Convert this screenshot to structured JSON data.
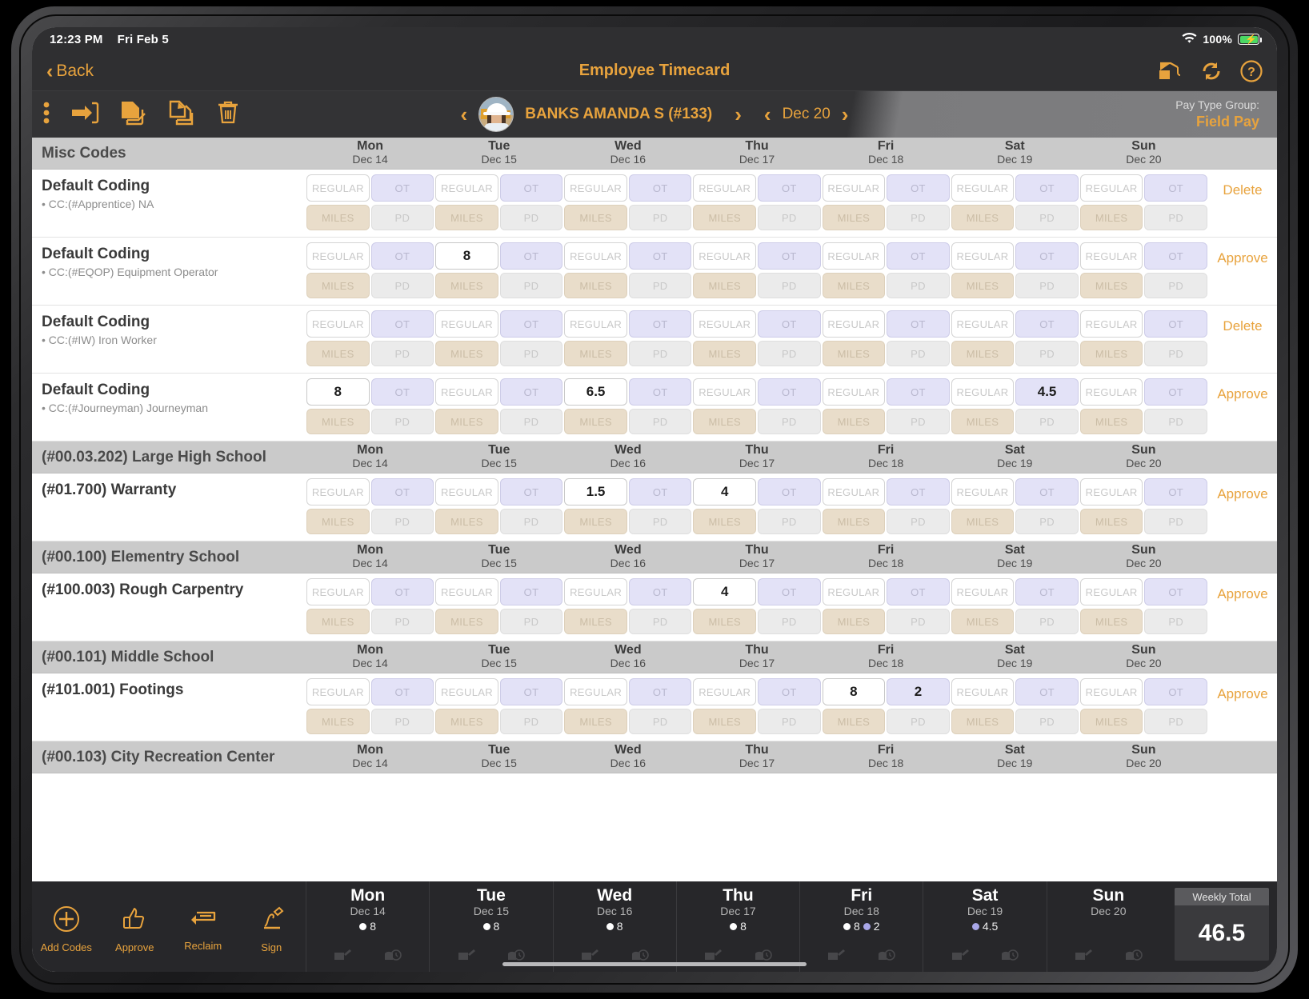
{
  "status_bar": {
    "time": "12:23 PM",
    "date": "Fri Feb 5",
    "battery_pct": "100%"
  },
  "nav": {
    "back_label": "Back",
    "title": "Employee Timecard",
    "icons": [
      "crane-icon",
      "refresh-icon",
      "help-icon"
    ]
  },
  "toolbar": {
    "icons": [
      "more-options-icon",
      "import-icon",
      "copy-document-icon",
      "duplicate-icon",
      "delete-icon"
    ],
    "employee": "BANKS AMANDA S (#133)",
    "week_label": "Dec 20",
    "pay_type_label": "Pay Type Group:",
    "pay_type_value": "Field Pay"
  },
  "colors": {
    "accent": "#E8A33D",
    "ot_fill": "#e3e2f7",
    "miles_fill": "#e9ddca",
    "pd_fill": "#ebebeb"
  },
  "cell_placeholders": {
    "regular": "REGULAR",
    "ot": "OT",
    "miles": "MILES",
    "pd": "PD"
  },
  "days": [
    {
      "name": "Mon",
      "date": "Dec 14"
    },
    {
      "name": "Tue",
      "date": "Dec 15"
    },
    {
      "name": "Wed",
      "date": "Dec 16"
    },
    {
      "name": "Thu",
      "date": "Dec 17"
    },
    {
      "name": "Fri",
      "date": "Dec 18"
    },
    {
      "name": "Sat",
      "date": "Dec 19"
    },
    {
      "name": "Sun",
      "date": "Dec 20"
    }
  ],
  "groups": [
    {
      "header": "Misc Codes",
      "rows": [
        {
          "title": "Default Coding",
          "subtitle": "• CC:(#Apprentice) NA",
          "action": "Delete",
          "regular": [
            "",
            "",
            "",
            "",
            "",
            "",
            ""
          ],
          "ot": [
            "",
            "",
            "",
            "",
            "",
            "",
            ""
          ],
          "miles": [
            "",
            "",
            "",
            "",
            "",
            "",
            ""
          ],
          "pd": [
            "",
            "",
            "",
            "",
            "",
            "",
            ""
          ]
        },
        {
          "title": "Default Coding",
          "subtitle": "• CC:(#EQOP) Equipment Operator",
          "action": "Approve",
          "regular": [
            "",
            "8",
            "",
            "",
            "",
            "",
            ""
          ],
          "ot": [
            "",
            "",
            "",
            "",
            "",
            "",
            ""
          ],
          "miles": [
            "",
            "",
            "",
            "",
            "",
            "",
            ""
          ],
          "pd": [
            "",
            "",
            "",
            "",
            "",
            "",
            ""
          ]
        },
        {
          "title": "Default Coding",
          "subtitle": "• CC:(#IW) Iron Worker",
          "action": "Delete",
          "regular": [
            "",
            "",
            "",
            "",
            "",
            "",
            ""
          ],
          "ot": [
            "",
            "",
            "",
            "",
            "",
            "",
            ""
          ],
          "miles": [
            "",
            "",
            "",
            "",
            "",
            "",
            ""
          ],
          "pd": [
            "",
            "",
            "",
            "",
            "",
            "",
            ""
          ]
        },
        {
          "title": "Default Coding",
          "subtitle": "• CC:(#Journeyman) Journeyman",
          "action": "Approve",
          "regular": [
            "8",
            "",
            "6.5",
            "",
            "",
            "",
            ""
          ],
          "ot": [
            "",
            "",
            "",
            "",
            "",
            "4.5",
            ""
          ],
          "miles": [
            "",
            "",
            "",
            "",
            "",
            "",
            ""
          ],
          "pd": [
            "",
            "",
            "",
            "",
            "",
            "",
            ""
          ]
        }
      ]
    },
    {
      "header": "(#00.03.202) Large High School",
      "rows": [
        {
          "title": "(#01.700) Warranty",
          "subtitle": "",
          "action": "Approve",
          "regular": [
            "",
            "",
            "1.5",
            "4",
            "",
            "",
            ""
          ],
          "ot": [
            "",
            "",
            "",
            "",
            "",
            "",
            ""
          ],
          "miles": [
            "",
            "",
            "",
            "",
            "",
            "",
            ""
          ],
          "pd": [
            "",
            "",
            "",
            "",
            "",
            "",
            ""
          ]
        }
      ]
    },
    {
      "header": "(#00.100) Elementry School",
      "rows": [
        {
          "title": "(#100.003) Rough Carpentry",
          "subtitle": "",
          "action": "Approve",
          "regular": [
            "",
            "",
            "",
            "4",
            "",
            "",
            ""
          ],
          "ot": [
            "",
            "",
            "",
            "",
            "",
            "",
            ""
          ],
          "miles": [
            "",
            "",
            "",
            "",
            "",
            "",
            ""
          ],
          "pd": [
            "",
            "",
            "",
            "",
            "",
            "",
            ""
          ]
        }
      ]
    },
    {
      "header": "(#00.101) Middle School",
      "rows": [
        {
          "title": "(#101.001) Footings",
          "subtitle": "",
          "action": "Approve",
          "regular": [
            "",
            "",
            "",
            "",
            "8",
            "",
            ""
          ],
          "ot": [
            "",
            "",
            "",
            "",
            "2",
            "",
            ""
          ],
          "miles": [
            "",
            "",
            "",
            "",
            "",
            "",
            ""
          ],
          "pd": [
            "",
            "",
            "",
            "",
            "",
            "",
            ""
          ]
        }
      ]
    },
    {
      "header": "(#00.103) City Recreation Center",
      "rows": []
    }
  ],
  "bottom_bar": {
    "actions": [
      {
        "label": "Add Codes",
        "icon": "add-circle-icon"
      },
      {
        "label": "Approve",
        "icon": "thumbs-up-icon"
      },
      {
        "label": "Reclaim",
        "icon": "reclaim-arrow-icon"
      },
      {
        "label": "Sign",
        "icon": "signature-icon"
      }
    ],
    "day_totals": [
      {
        "name": "Mon",
        "date": "Dec 14",
        "dots": [
          {
            "type": "w",
            "value": "8"
          }
        ]
      },
      {
        "name": "Tue",
        "date": "Dec 15",
        "dots": [
          {
            "type": "w",
            "value": "8"
          }
        ]
      },
      {
        "name": "Wed",
        "date": "Dec 16",
        "dots": [
          {
            "type": "w",
            "value": "8"
          }
        ]
      },
      {
        "name": "Thu",
        "date": "Dec 17",
        "dots": [
          {
            "type": "w",
            "value": "8"
          }
        ]
      },
      {
        "name": "Fri",
        "date": "Dec 18",
        "dots": [
          {
            "type": "w",
            "value": "8"
          },
          {
            "type": "v",
            "value": "2"
          }
        ]
      },
      {
        "name": "Sat",
        "date": "Dec 19",
        "dots": [
          {
            "type": "v",
            "value": "4.5"
          }
        ]
      },
      {
        "name": "Sun",
        "date": "Dec 20",
        "dots": []
      }
    ],
    "weekly_total_label": "Weekly Total",
    "weekly_total_value": "46.5"
  }
}
